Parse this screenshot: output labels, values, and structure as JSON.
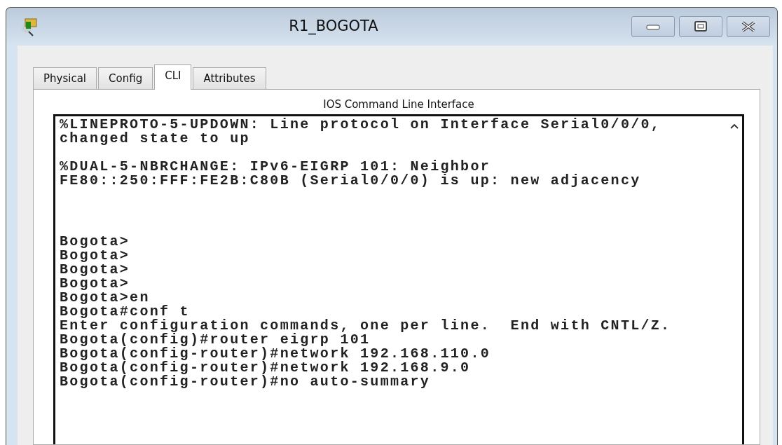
{
  "window": {
    "title": "R1_BOGOTA"
  },
  "tabs": [
    {
      "label": "Physical",
      "selected": false
    },
    {
      "label": "Config",
      "selected": false
    },
    {
      "label": "CLI",
      "selected": true
    },
    {
      "label": "Attributes",
      "selected": false
    }
  ],
  "panel_title": "IOS Command Line Interface",
  "terminal": {
    "blocks": [
      {
        "lines": [
          "%LINEPROTO-5-UPDOWN: Line protocol on Interface Serial0/0/0,",
          "changed state to up"
        ]
      },
      {
        "lines": [
          "%DUAL-5-NBRCHANGE: IPv6-EIGRP 101: Neighbor",
          "FE80::250:FFF:FE2B:C80B (Serial0/0/0) is up: new adjacency"
        ]
      },
      {
        "lines": [
          "Bogota>",
          "Bogota>",
          "Bogota>",
          "Bogota>",
          "Bogota>en",
          "Bogota#conf t",
          "Enter configuration commands, one per line.  End with CNTL/Z.",
          "Bogota(config)#router eigrp 101",
          "Bogota(config-router)#network 192.168.110.0",
          "Bogota(config-router)#network 192.168.9.0",
          "Bogota(config-router)#no auto-summary"
        ]
      }
    ]
  }
}
